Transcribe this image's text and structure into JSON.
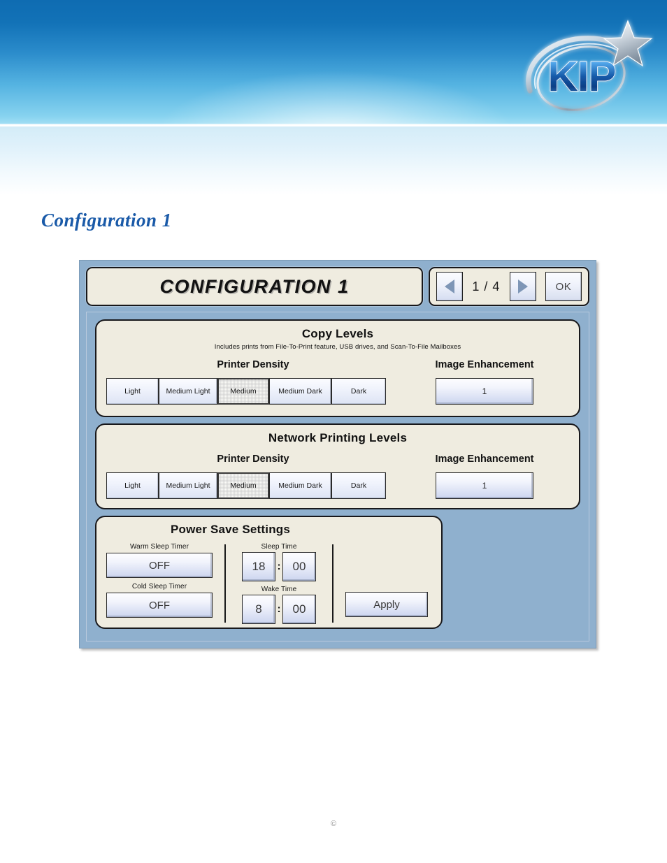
{
  "brand": {
    "logo_text": "KIP",
    "logo_name": "kip-logo"
  },
  "page": {
    "title": "Configuration 1"
  },
  "screen": {
    "title": "CONFIGURATION 1",
    "nav": {
      "prev_icon": "triangle-left-icon",
      "next_icon": "triangle-right-icon",
      "page_indicator": "1 / 4",
      "ok_label": "OK"
    },
    "copy_levels": {
      "title": "Copy Levels",
      "subtitle": "Includes prints from File-To-Print feature, USB drives, and Scan-To-File Mailboxes",
      "density_label": "Printer Density",
      "density_options": [
        "Light",
        "Medium Light",
        "Medium",
        "Medium Dark",
        "Dark"
      ],
      "density_selected": "Medium",
      "enhancement_label": "Image Enhancement",
      "enhancement_value": "1"
    },
    "network_levels": {
      "title": "Network Printing Levels",
      "density_label": "Printer Density",
      "density_options": [
        "Light",
        "Medium Light",
        "Medium",
        "Medium Dark",
        "Dark"
      ],
      "density_selected": "Medium",
      "enhancement_label": "Image Enhancement",
      "enhancement_value": "1"
    },
    "power_save": {
      "title": "Power Save Settings",
      "warm_sleep_label": "Warm Sleep Timer",
      "warm_sleep_value": "OFF",
      "cold_sleep_label": "Cold Sleep Timer",
      "cold_sleep_value": "OFF",
      "sleep_time_label": "Sleep Time",
      "sleep_hour": "18",
      "sleep_minute": "00",
      "wake_time_label": "Wake Time",
      "wake_hour": "8",
      "wake_minute": "00",
      "time_separator": ":",
      "apply_label": "Apply"
    }
  },
  "footer": {
    "copyright": "©"
  },
  "colors": {
    "banner_top": "#0f6cb2",
    "banner_bottom": "#a6e0f5",
    "panel_blue": "#8fb0ce",
    "bezel_cream": "#efece0",
    "title_blue": "#1a5aa8",
    "button_blue": "#ccd5ef"
  }
}
